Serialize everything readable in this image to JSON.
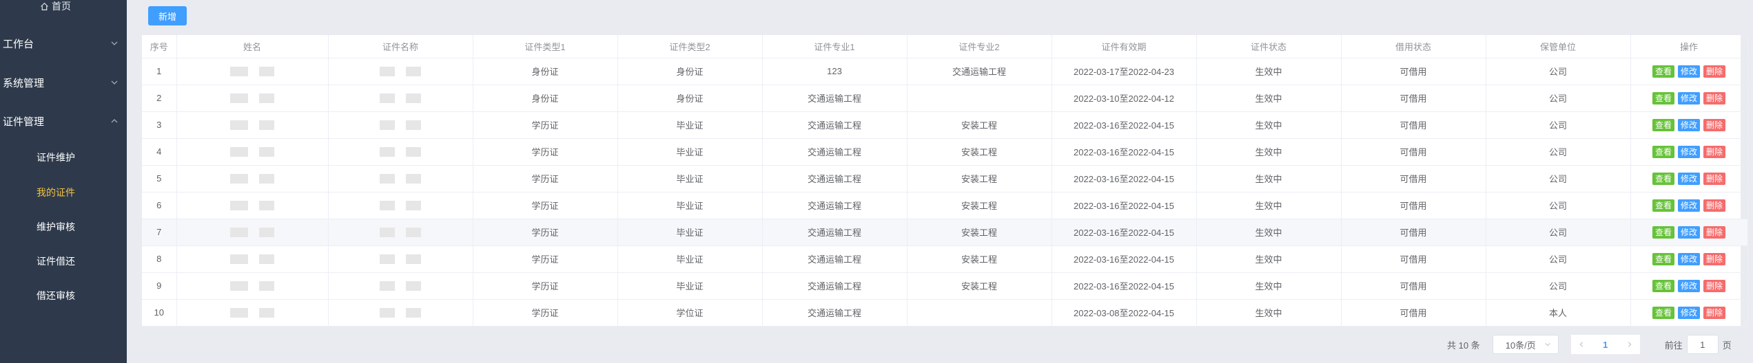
{
  "sidebar": {
    "home": "首页",
    "menus": [
      {
        "label": "工作台"
      },
      {
        "label": "系统管理"
      },
      {
        "label": "证件管理"
      }
    ],
    "submenus": [
      {
        "label": "证件维护"
      },
      {
        "label": "我的证件",
        "active": true
      },
      {
        "label": "维护审核"
      },
      {
        "label": "证件借还"
      },
      {
        "label": "借还审核"
      }
    ]
  },
  "toolbar": {
    "add_label": "新增"
  },
  "table": {
    "headers": [
      "序号",
      "姓名",
      "证件名称",
      "证件类型1",
      "证件类型2",
      "证件专业1",
      "证件专业2",
      "证件有效期",
      "证件状态",
      "借用状态",
      "保管单位",
      "操作"
    ],
    "rows": [
      {
        "no": "1",
        "type1": "身份证",
        "type2": "身份证",
        "major1": "123",
        "major2": "交通运输工程",
        "validity": "2022-03-17至2022-04-23",
        "status": "生效中",
        "borrow": "可借用",
        "unit": "公司"
      },
      {
        "no": "2",
        "type1": "身份证",
        "type2": "身份证",
        "major1": "交通运输工程",
        "major2": "",
        "validity": "2022-03-10至2022-04-12",
        "status": "生效中",
        "borrow": "可借用",
        "unit": "公司"
      },
      {
        "no": "3",
        "type1": "学历证",
        "type2": "毕业证",
        "major1": "交通运输工程",
        "major2": "安装工程",
        "validity": "2022-03-16至2022-04-15",
        "status": "生效中",
        "borrow": "可借用",
        "unit": "公司"
      },
      {
        "no": "4",
        "type1": "学历证",
        "type2": "毕业证",
        "major1": "交通运输工程",
        "major2": "安装工程",
        "validity": "2022-03-16至2022-04-15",
        "status": "生效中",
        "borrow": "可借用",
        "unit": "公司"
      },
      {
        "no": "5",
        "type1": "学历证",
        "type2": "毕业证",
        "major1": "交通运输工程",
        "major2": "安装工程",
        "validity": "2022-03-16至2022-04-15",
        "status": "生效中",
        "borrow": "可借用",
        "unit": "公司"
      },
      {
        "no": "6",
        "type1": "学历证",
        "type2": "毕业证",
        "major1": "交通运输工程",
        "major2": "安装工程",
        "validity": "2022-03-16至2022-04-15",
        "status": "生效中",
        "borrow": "可借用",
        "unit": "公司"
      },
      {
        "no": "7",
        "type1": "学历证",
        "type2": "毕业证",
        "major1": "交通运输工程",
        "major2": "安装工程",
        "validity": "2022-03-16至2022-04-15",
        "status": "生效中",
        "borrow": "可借用",
        "unit": "公司"
      },
      {
        "no": "8",
        "type1": "学历证",
        "type2": "毕业证",
        "major1": "交通运输工程",
        "major2": "安装工程",
        "validity": "2022-03-16至2022-04-15",
        "status": "生效中",
        "borrow": "可借用",
        "unit": "公司"
      },
      {
        "no": "9",
        "type1": "学历证",
        "type2": "毕业证",
        "major1": "交通运输工程",
        "major2": "安装工程",
        "validity": "2022-03-16至2022-04-15",
        "status": "生效中",
        "borrow": "可借用",
        "unit": "公司"
      },
      {
        "no": "10",
        "type1": "学历证",
        "type2": "学位证",
        "major1": "交通运输工程",
        "major2": "",
        "validity": "2022-03-08至2022-04-15",
        "status": "生效中",
        "borrow": "可借用",
        "unit": "本人"
      }
    ],
    "actions": {
      "view": "查看",
      "edit": "修改",
      "delete": "删除"
    }
  },
  "pagination": {
    "total": "共 10 条",
    "page_size": "10条/页",
    "current_page": "1",
    "goto_prefix": "前往",
    "goto_value": "1",
    "goto_suffix": "页"
  },
  "colors": {
    "sidebar_bg": "#2e3a4b",
    "active_menu": "#f2c141",
    "primary": "#409eff",
    "success": "#67c23a",
    "danger": "#f56c6c"
  }
}
